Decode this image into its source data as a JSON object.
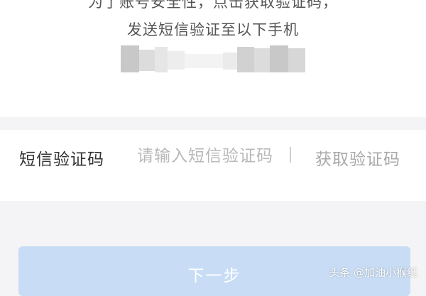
{
  "info": {
    "line1": "为了账号安全性，点击获取验证码，",
    "line2": "发送短信验证至以下手机"
  },
  "sms_row": {
    "label": "短信验证码",
    "input_placeholder": "请输入短信验证码",
    "divider": "|",
    "get_code_label": "获取验证码"
  },
  "next_button": {
    "label": "下一步"
  },
  "watermark": {
    "text": "头条 @加油小猴纸"
  },
  "colors": {
    "panel_bg": "#ffffff",
    "page_bg": "#f4f4f6",
    "button_bg": "#c8ddf5",
    "placeholder": "#b8b8b8"
  }
}
